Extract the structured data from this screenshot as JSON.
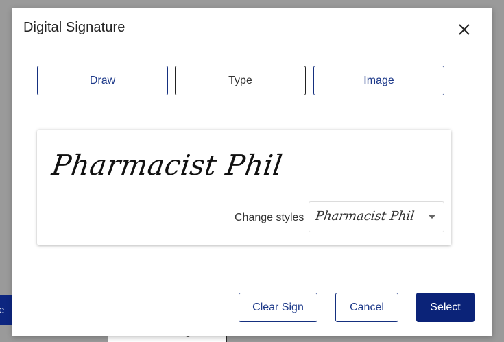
{
  "background": {
    "left_button_label": "e"
  },
  "dialog": {
    "title": "Digital Signature",
    "close_icon": "close-icon",
    "modes": {
      "draw": "Draw",
      "type": "Type",
      "image": "Image",
      "active": "Type"
    },
    "signature": {
      "preview_text": "Pharmacist Phil",
      "change_styles_label": "Change styles",
      "selected_style": "Pharmacist Phil",
      "dropdown_icon": "caret-down-icon"
    },
    "footer": {
      "clear_label": "Clear Sign",
      "cancel_label": "Cancel",
      "select_label": "Select"
    }
  },
  "colors": {
    "primary": "#0b2378",
    "border": "#15307f",
    "overlay": "#9a9a9a"
  }
}
